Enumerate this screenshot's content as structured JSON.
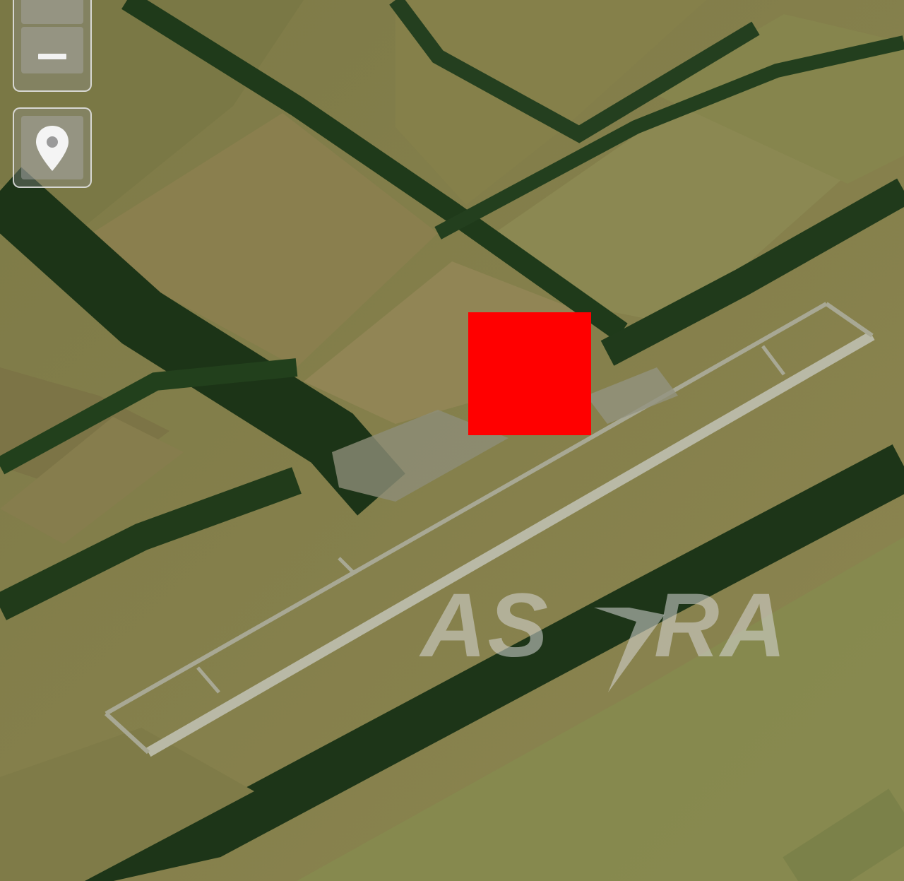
{
  "map": {
    "view": "satellite",
    "subject": "airfield"
  },
  "controls": {
    "zoom_in_icon": "plus-icon",
    "zoom_out_icon": "minus-icon",
    "locate_icon": "map-pin-icon"
  },
  "marker": {
    "color": "#ff0000"
  },
  "watermark": {
    "text_left": "AS",
    "text_right": "RA",
    "icon": "star-bolt-icon"
  },
  "colors": {
    "field_light": "#8a8450",
    "field_dark": "#6f7140",
    "forest": "#1f3a1a",
    "runway": "#b9b9a6"
  }
}
